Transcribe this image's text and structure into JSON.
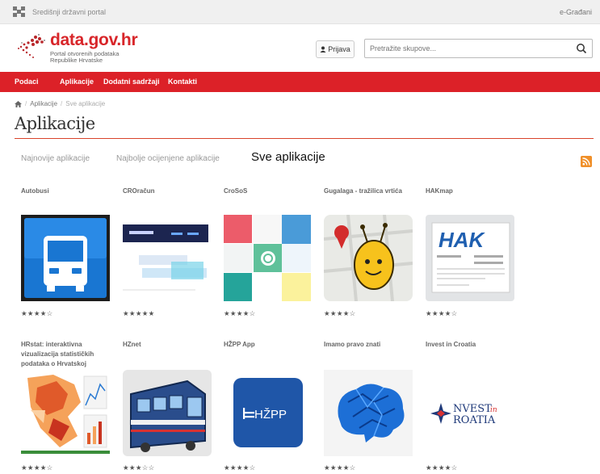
{
  "topbar": {
    "gov_portal": "Središnji državni portal",
    "right_link": "e-Građani"
  },
  "brand": {
    "title": "data.gov.hr",
    "subtitle_line1": "Portal otvorenih podataka",
    "subtitle_line2": "Republike Hrvatske"
  },
  "header": {
    "login_icon": "user-icon",
    "login_label": "Prijava",
    "search_placeholder": "Pretražite skupove...",
    "search_icon": "search-icon"
  },
  "nav": {
    "items": [
      "Podaci",
      "Aplikacije",
      "Dodatni sadržaji",
      "Kontakti"
    ]
  },
  "breadcrumb": {
    "home_icon": "home-icon",
    "items": [
      "Aplikacije",
      "Sve aplikacije"
    ]
  },
  "page": {
    "title": "Aplikacije"
  },
  "tabs": {
    "items": [
      "Najnovije aplikacije",
      "Najbolje ocijenjene aplikacije",
      "Sve aplikacije"
    ],
    "active": "Sve aplikacije",
    "rss_icon": "rss-icon"
  },
  "apps": [
    {
      "title": "Autobusi",
      "rating": 4,
      "thumb": "bus-icon"
    },
    {
      "title": "CROračun",
      "rating": 5,
      "thumb": "screenshot"
    },
    {
      "title": "CroSoS",
      "rating": 4,
      "thumb": "colored-tiles"
    },
    {
      "title": "Gugalaga - tražilica vrtića",
      "rating": 4,
      "thumb": "mascot-map"
    },
    {
      "title": "HAKmap",
      "rating": 4,
      "thumb": "hak-card"
    },
    {
      "title": "HRstat: interaktivna vizualizacija statističkih podataka o Hrvatskoj",
      "rating": 4,
      "thumb": "map-chart"
    },
    {
      "title": "HZnet",
      "rating": 3,
      "thumb": "train"
    },
    {
      "title": "HŽPP App",
      "rating": 4,
      "thumb": "hzpp-logo"
    },
    {
      "title": "Imamo pravo znati",
      "rating": 4,
      "thumb": "brain"
    },
    {
      "title": "Invest in Croatia",
      "rating": 4,
      "thumb": "invest-logo"
    }
  ],
  "logos": {
    "hzpp": "HŽPP",
    "invest_line1": "NVEST",
    "invest_in": "in",
    "invest_line2": "ROATIA",
    "hak": "HAK"
  },
  "colors": {
    "brand_red": "#dc2128",
    "rule_orange": "#d9432a",
    "rss_orange": "#f0902a"
  }
}
